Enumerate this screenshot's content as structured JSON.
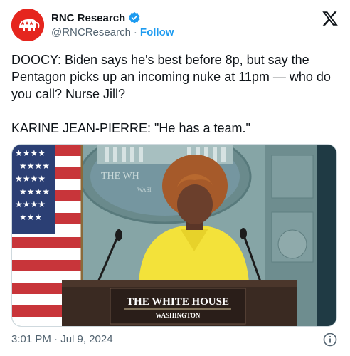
{
  "tweet": {
    "display_name": "RNC Research",
    "handle": "@RNCResearch",
    "separator": "·",
    "follow_label": "Follow",
    "paragraphs": [
      "DOOCY: Biden says he's best before 8p, but say the Pentagon picks up an incoming nuke at 11pm — who do you call? Nurse Jill?",
      "KARINE JEAN-PIERRE: \"He has a team.\""
    ],
    "timestamp": "3:01 PM · Jul 9, 2024"
  },
  "media": {
    "seal_text": "THE WH",
    "seal_subtext": "WASI",
    "podium_title": "THE WHITE HOUSE",
    "podium_subtitle": "WASHINGTON"
  },
  "icons": {
    "avatar": "rnc-elephant-logo",
    "verified": "verified-badge-icon",
    "brand": "x-logo-icon",
    "info": "info-icon"
  },
  "colors": {
    "accent": "#1d9bf0",
    "avatar_bg": "#e5261e",
    "text": "#0f1419",
    "muted": "#536471"
  }
}
